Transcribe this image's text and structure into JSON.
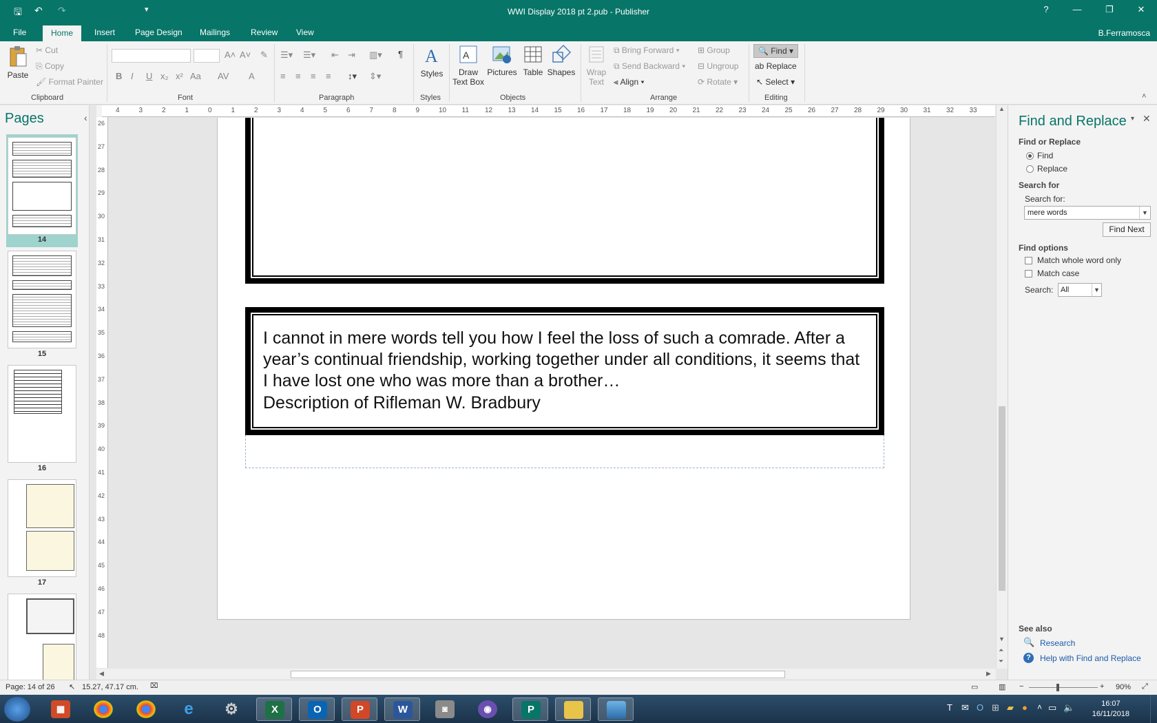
{
  "window": {
    "title": "WWI Display 2018 pt 2.pub - Publisher",
    "help": "?",
    "minimize": "—",
    "restore": "❐",
    "close": "✕"
  },
  "qat": {
    "save": "🖫",
    "undo": "↶",
    "redo": "↷",
    "customize": "▾"
  },
  "tabs": [
    "File",
    "Home",
    "Insert",
    "Page Design",
    "Mailings",
    "Review",
    "View"
  ],
  "user": "B.Ferramosca",
  "ribbon": {
    "clipboard": {
      "paste": "Paste",
      "cut": "Cut",
      "copy": "Copy",
      "format_painter": "Format Painter",
      "label": "Clipboard"
    },
    "font": {
      "label": "Font",
      "bold": "B",
      "italic": "I",
      "underline": "U",
      "sub": "x₂",
      "sup": "x²",
      "case": "Aa",
      "spacing": "AV",
      "color": "A"
    },
    "paragraph": {
      "label": "Paragraph",
      "pilcrow": "¶"
    },
    "styles": {
      "button": "Styles",
      "label": "Styles"
    },
    "objects": {
      "label": "Objects",
      "draw_text_box_1": "Draw",
      "draw_text_box_2": "Text Box",
      "pictures": "Pictures",
      "table": "Table",
      "shapes": "Shapes"
    },
    "arrange": {
      "label": "Arrange",
      "wrap_text_1": "Wrap",
      "wrap_text_2": "Text",
      "bring_forward": "Bring Forward",
      "send_backward": "Send Backward",
      "align": "Align",
      "group": "Group",
      "ungroup": "Ungroup",
      "rotate": "Rotate"
    },
    "editing": {
      "label": "Editing",
      "find": "Find",
      "replace": "Replace",
      "select": "Select"
    }
  },
  "pages_panel": {
    "title": "Pages",
    "collapse": "‹",
    "thumbs": [
      {
        "num": "14",
        "selected": true
      },
      {
        "num": "15",
        "selected": false
      },
      {
        "num": "16",
        "selected": false
      },
      {
        "num": "17",
        "selected": false
      }
    ]
  },
  "ruler": {
    "h_labels": [
      "4",
      "3",
      "2",
      "1",
      "0",
      "1",
      "2",
      "3",
      "4",
      "5",
      "6",
      "7",
      "8",
      "9",
      "10",
      "11",
      "12",
      "13",
      "14",
      "15",
      "16",
      "17",
      "18",
      "19",
      "20",
      "21",
      "22",
      "23",
      "24",
      "25",
      "26",
      "27",
      "28",
      "29",
      "30",
      "31",
      "32",
      "33"
    ],
    "v_labels": [
      "26",
      "27",
      "28",
      "29",
      "30",
      "31",
      "32",
      "33",
      "34",
      "35",
      "36",
      "37",
      "38",
      "39",
      "40",
      "41",
      "42",
      "43",
      "44",
      "45",
      "46",
      "47",
      "48"
    ]
  },
  "document": {
    "quote": "I cannot in mere words tell you how I feel the loss of such a comrade. After a year’s continual friendship, working together under all conditions, it seems that I have lost one who was more than a brother…",
    "attribution": "Description of Rifleman W. Bradbury"
  },
  "find_pane": {
    "title": "Find and Replace",
    "find_or_replace": "Find or Replace",
    "opt_find": "Find",
    "opt_replace": "Replace",
    "search_for_header": "Search for",
    "search_for_label": "Search for:",
    "search_value": "mere words",
    "find_next": "Find Next",
    "find_options": "Find options",
    "match_whole_word": "Match whole word only",
    "match_case": "Match case",
    "search_label": "Search:",
    "search_scope": "All",
    "see_also": "See also",
    "research": "Research",
    "help": "Help with Find and Replace"
  },
  "status": {
    "page": "Page: 14 of 26",
    "position": "15.27, 47.17 cm.",
    "zoom": "90%"
  },
  "taskbar": {
    "clock_time": "16:07",
    "clock_date": "16/11/2018",
    "apps": [
      "start",
      "apps",
      "chrome",
      "chrome",
      "internet-explorer",
      "settings",
      "excel",
      "outlook",
      "powerpoint",
      "word",
      "camera",
      "app",
      "publisher",
      "explorer",
      "photos"
    ]
  }
}
